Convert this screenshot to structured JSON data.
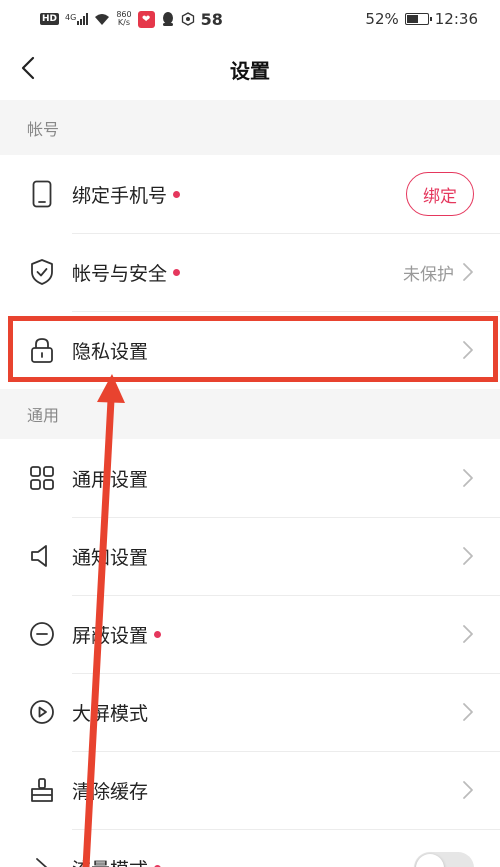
{
  "status_bar": {
    "hd": "HD",
    "signal": "4G",
    "speed_value": "860",
    "speed_unit": "K/s",
    "notification_count": "58",
    "battery_percent": "52%",
    "time": "12:36"
  },
  "nav": {
    "title": "设置"
  },
  "sections": {
    "account": {
      "header": "帐号",
      "bind_phone": {
        "label": "绑定手机号",
        "button": "绑定"
      },
      "account_security": {
        "label": "帐号与安全",
        "value": "未保护"
      },
      "privacy": {
        "label": "隐私设置"
      }
    },
    "general": {
      "header": "通用",
      "general_settings": {
        "label": "通用设置"
      },
      "notification_settings": {
        "label": "通知设置"
      },
      "block_settings": {
        "label": "屏蔽设置"
      },
      "large_screen": {
        "label": "大屏模式"
      },
      "clear_cache": {
        "label": "清除缓存"
      },
      "last_item": {
        "label": "流量模式"
      }
    }
  },
  "colors": {
    "accent": "#e5375d",
    "annotation": "#e8432f"
  }
}
